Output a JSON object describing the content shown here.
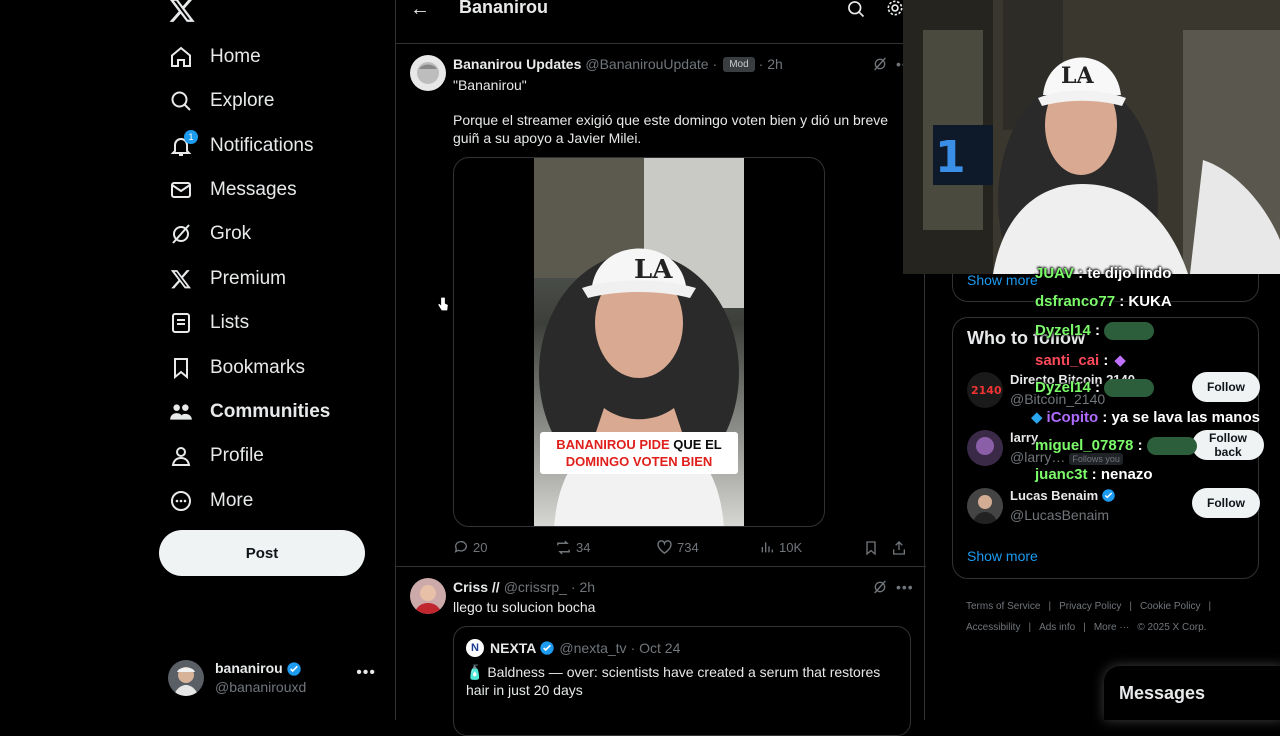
{
  "sidebar": {
    "items": [
      {
        "label": "Home",
        "icon": "home-icon"
      },
      {
        "label": "Explore",
        "icon": "search-icon"
      },
      {
        "label": "Notifications",
        "icon": "bell-icon",
        "badge": "1"
      },
      {
        "label": "Messages",
        "icon": "mail-icon"
      },
      {
        "label": "Grok",
        "icon": "grok-icon"
      },
      {
        "label": "Premium",
        "icon": "x-logo-icon"
      },
      {
        "label": "Lists",
        "icon": "list-icon"
      },
      {
        "label": "Bookmarks",
        "icon": "bookmark-icon"
      },
      {
        "label": "Communities",
        "icon": "communities-icon"
      },
      {
        "label": "Profile",
        "icon": "profile-icon"
      },
      {
        "label": "More",
        "icon": "more-circle-icon"
      }
    ],
    "post_label": "Post",
    "account": {
      "name": "bananirou",
      "handle": "@bananirouxd"
    }
  },
  "header": {
    "title": "Bananirou"
  },
  "tweets": [
    {
      "name": "Bananirou Updates",
      "handle": "@BananirouUpdate",
      "badge": "Mod",
      "time": "· 2h",
      "text1": "\"Bananirou\"",
      "text2": "Porque el streamer exigió que este domingo voten bien y dió un breve guiñ a su apoyo a Javier Milei.",
      "video_caption": {
        "line1a": "BANANIROU PIDE",
        "line1b": " QUE EL",
        "line2": "DOMINGO VOTEN BIEN"
      },
      "stats": {
        "replies": "20",
        "reposts": "34",
        "likes": "734",
        "views": "10K"
      }
    },
    {
      "name": "Criss //",
      "handle": "@crissrp_",
      "time": "· 2h",
      "text": "llego tu solucion bocha",
      "quote": {
        "name": "NEXTA",
        "handle": "@nexta_tv",
        "time": "· Oct 24",
        "text": "🧴 Baldness — over: scientists have created a serum that restores hair in just 20 days"
      }
    }
  ],
  "right": {
    "show_more_top": "Show more",
    "who_to_follow": "Who to follow",
    "suggestions": [
      {
        "name": "Directo Bitcoin 2140",
        "handle": "@Bitcoin_2140",
        "button": "Follow"
      },
      {
        "name": "larry",
        "handle": "@larry…",
        "sub": "Follows you",
        "button": "Follow back"
      },
      {
        "name": "Lucas Benaim",
        "handle": "@LucasBenaim",
        "button": "Follow"
      }
    ],
    "show_more": "Show more",
    "footer": [
      "Terms of Service",
      "|",
      "Privacy Policy",
      "|",
      "Cookie Policy",
      "|",
      "Accessibility",
      "|",
      "Ads info",
      "|",
      "More ···",
      "© 2025 X Corp."
    ],
    "messages": "Messages"
  },
  "chat": [
    {
      "user": "JUAV",
      "msg": " : te dijo lindo",
      "color": "#7cfc6a"
    },
    {
      "user": "dsfranco77",
      "msg": " : KUKA",
      "color": "#7cfc6a"
    },
    {
      "user": "Dyzel14",
      "msg": " :",
      "color": "#7cfc6a",
      "emote": true
    },
    {
      "user": "santi_cai",
      "msg": " :",
      "color": "#ff4a5a"
    },
    {
      "user": "Dyzel14",
      "msg": " :",
      "color": "#7cfc6a",
      "emote": true
    },
    {
      "user": "iCopito",
      "msg": " : ya se lava las manos",
      "color": "#b06bff"
    },
    {
      "user": "miguel_07878",
      "msg": " :",
      "color": "#7cfc6a",
      "emote": true
    },
    {
      "user": "juanc3t",
      "msg": " : nenazo",
      "color": "#7cfc6a"
    }
  ],
  "colors": {
    "accent": "#1d9bf0",
    "background": "#000000",
    "border": "#2f3336"
  }
}
